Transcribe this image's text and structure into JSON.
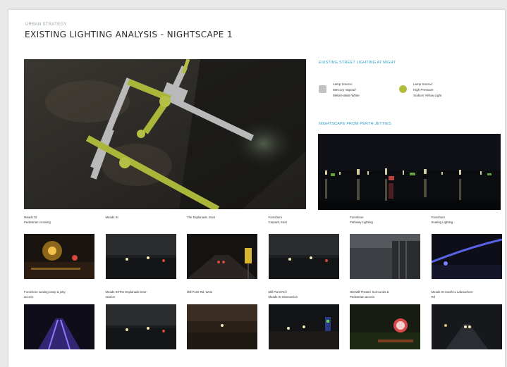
{
  "header": {
    "kicker": "URBAN STRATEGY",
    "title": "EXISTING LIGHTING ANALYSIS - NIGHTSCAPE 1"
  },
  "sidebar": {
    "legend_heading": "EXISTING STREET LIGHTING AT NIGHT",
    "legend": [
      {
        "color": "#c2c2c2",
        "shape": "square",
        "lines": [
          "Lamp Source:",
          "Mercury Vapour/",
          "Metal Halide White"
        ]
      },
      {
        "color": "#b3bd3c",
        "shape": "circle",
        "lines": [
          "Lamp Source:",
          "High Pressure",
          "Sodium Yellow Light"
        ]
      }
    ],
    "nightscape_heading": "NIGHTSCAPE FROM PERTH JETTIES"
  },
  "photos": [
    {
      "caption": [
        "Meads St",
        "Pedestrian crossing"
      ],
      "scene": "warm"
    },
    {
      "caption": [
        "Meads St"
      ],
      "scene": "dim"
    },
    {
      "caption": [
        "The Esplanade, East"
      ],
      "scene": "road"
    },
    {
      "caption": [
        "Foreshore",
        "Carpark, East"
      ],
      "scene": "dim"
    },
    {
      "caption": [
        "Foreshore",
        "Pathway Lighting"
      ],
      "scene": "grey"
    },
    {
      "caption": [
        "Foreshore",
        "Seating Lighting"
      ],
      "scene": "blue"
    },
    {
      "caption": [
        "Foreshore seating ramp & jetty",
        "access"
      ],
      "scene": "bluefloor"
    },
    {
      "caption": [
        "Meads St/The Esplanade Inter-",
        "section"
      ],
      "scene": "dim"
    },
    {
      "caption": [
        "Mill Point Rd, West"
      ],
      "scene": "brown"
    },
    {
      "caption": [
        "Mill Point Rd /",
        "Meads St Intersection"
      ],
      "scene": "signal"
    },
    {
      "caption": [
        "Old Mill Theatre Surrounds &",
        "Pedestrian access"
      ],
      "scene": "sign"
    },
    {
      "caption": [
        "Meads St South to Labouchere",
        "Rd"
      ],
      "scene": "street"
    }
  ]
}
